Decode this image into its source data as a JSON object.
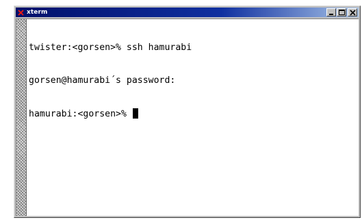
{
  "window": {
    "title": "xterm",
    "title_icon": "x-logo-icon",
    "controls": [
      "minimize-icon",
      "maximize-icon",
      "close-icon"
    ]
  },
  "terminal": {
    "lines": [
      "twister:<gorsen>% ssh hamurabi",
      "gorsen@hamurabi´s password:",
      "hamurabi:<gorsen>% "
    ],
    "cursor": "block"
  },
  "colors": {
    "title_bar": "#00106a",
    "title_text": "#ffffff",
    "terminal_bg": "#ffffff",
    "terminal_fg": "#000000",
    "icon_accent": "#d01010"
  }
}
